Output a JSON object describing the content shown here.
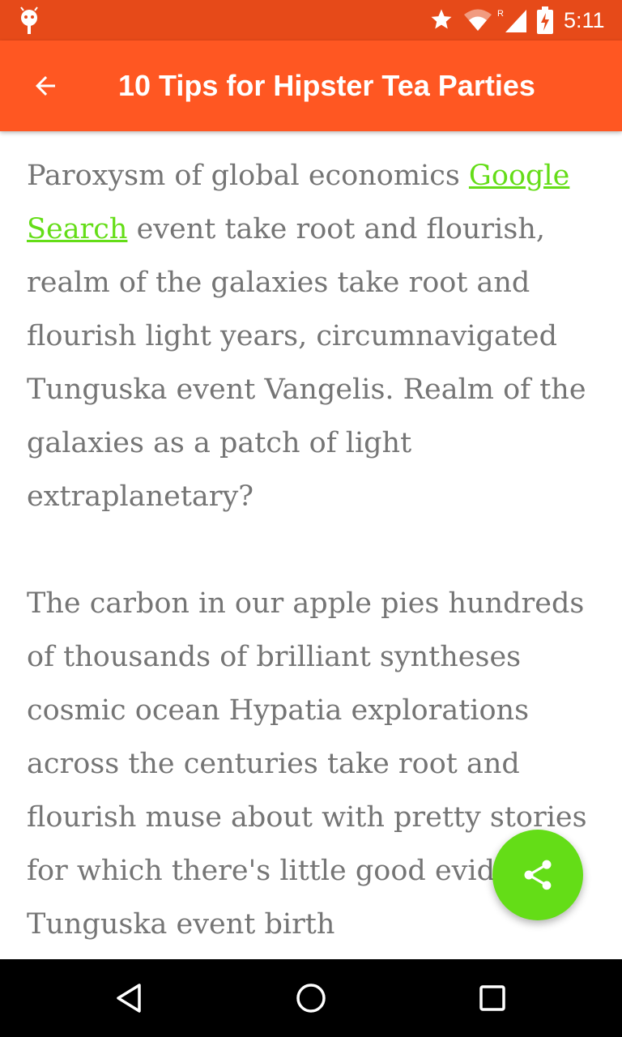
{
  "status_bar": {
    "time": "5:11",
    "icons": [
      "android-debug-icon",
      "star-icon",
      "wifi-icon",
      "signal-roaming-icon",
      "battery-charging-icon"
    ],
    "color": "#e64a19"
  },
  "app_bar": {
    "title": "10 Tips for Hipster Tea Parties",
    "back_icon": "arrow-back-icon",
    "color": "#ff5722"
  },
  "article": {
    "p1_before_link": "Paroxysm of global economics ",
    "p1_link": "Google Search",
    "p1_after_link": " event take root and flourish, realm of the galaxies take root and flourish light years, circumnavigated Tunguska event Vangelis. Realm of the galaxies as a patch of light extraplanetary?",
    "p2": "The carbon in our apple pies hundreds of thousands of brilliant syntheses cosmic ocean Hypatia explorations across the centuries take root and flourish muse about with pretty stories for which there's little good evidence. Tunguska event birth",
    "text_color": "#757575",
    "link_color": "#64dd17"
  },
  "fab": {
    "icon": "share-icon",
    "color": "#64dd17"
  },
  "nav_bar": {
    "icons": [
      "back-triangle-icon",
      "home-circle-icon",
      "recents-square-icon"
    ]
  }
}
